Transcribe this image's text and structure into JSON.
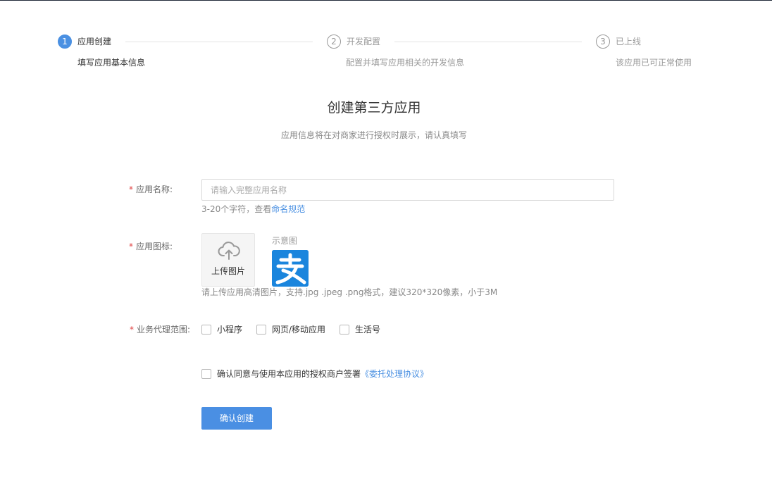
{
  "steps": [
    {
      "number": "1",
      "title": "应用创建",
      "desc": "填写应用基本信息",
      "state": "active"
    },
    {
      "number": "2",
      "title": "开发配置",
      "desc": "配置并填写应用相关的开发信息",
      "state": "inactive"
    },
    {
      "number": "3",
      "title": "已上线",
      "desc": "该应用已可正常使用",
      "state": "inactive"
    }
  ],
  "header": {
    "title": "创建第三方应用",
    "subtitle": "应用信息将在对商家进行授权时展示，请认真填写"
  },
  "form": {
    "required_mark": "*",
    "name_label": "应用名称:",
    "name_placeholder": "请输入完整应用名称",
    "name_value": "",
    "name_hint_prefix": "3-20个字符，查看",
    "name_hint_link": "命名规范",
    "icon_label": "应用图标:",
    "upload_text": "上传图片",
    "sample_label": "示意图",
    "icon_hint": "请上传应用高清图片，支持.jpg .jpeg .png格式，建议320*320像素，小于3M",
    "scope_label": "业务代理范围:",
    "scope_options": [
      {
        "label": "小程序",
        "checked": false
      },
      {
        "label": "网页/移动应用",
        "checked": false
      },
      {
        "label": "生活号",
        "checked": false
      }
    ],
    "agreement_text": "确认同意与使用本应用的授权商户签署",
    "agreement_link": "《委托处理协议》",
    "agreement_checked": false,
    "submit_label": "确认创建"
  },
  "icons": {
    "upload": "cloud-upload-icon",
    "sample": "alipay-logo-icon"
  },
  "colors": {
    "accent": "#4a90e2",
    "required": "#e04545",
    "sample_bg": "#1a85dd"
  }
}
